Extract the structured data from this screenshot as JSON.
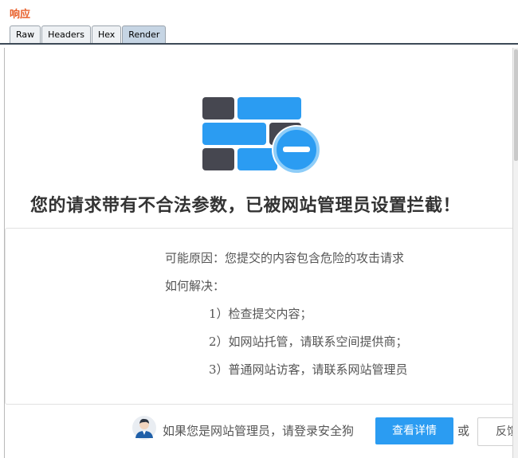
{
  "panel": {
    "title": "响应",
    "tabs": [
      {
        "label": "Raw",
        "active": false
      },
      {
        "label": "Headers",
        "active": false
      },
      {
        "label": "Hex",
        "active": false
      },
      {
        "label": "Render",
        "active": true
      }
    ]
  },
  "page": {
    "headline": "您的请求带有不合法参数，已被网站管理员设置拦截！",
    "reason": "可能原因：您提交的内容包含危险的攻击请求",
    "how_to_resolve": "如何解决：",
    "steps": [
      "1）检查提交内容；",
      "2）如网站托管，请联系空间提供商；",
      "3）普通网站访客，请联系网站管理员"
    ],
    "admin_prompt": "如果您是网站管理员，请登录安全狗",
    "detail_button": "查看详情",
    "or_text": "或",
    "feedback_button": "反馈"
  },
  "colors": {
    "accent_blue": "#2b9cf2",
    "dark_brick": "#464750",
    "title_orange": "#e8612c"
  },
  "icons": {
    "illustration": "blocked-wall-icon",
    "avatar": "admin-avatar-icon"
  }
}
